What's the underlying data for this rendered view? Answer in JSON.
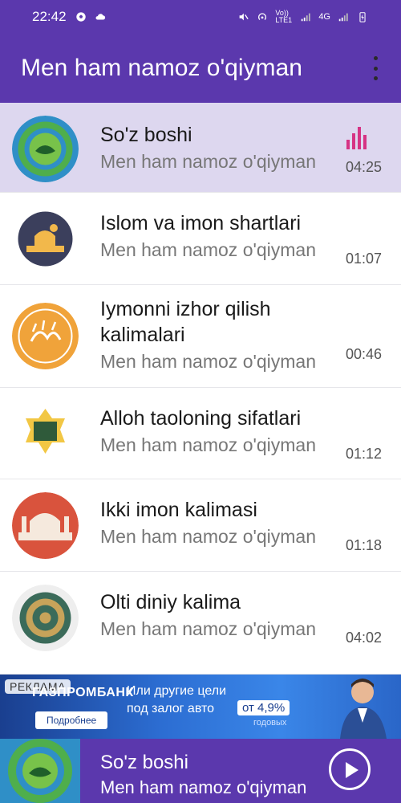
{
  "status": {
    "time": "22:42",
    "left_icons": [
      "football-icon",
      "cloud-icon"
    ],
    "right_icons": [
      "mute-icon",
      "hotspot-icon",
      "volte-icon",
      "signal-icon",
      "signal-icon",
      "battery-charging-icon"
    ],
    "volte": "Vo)) LTE1",
    "net": "4G"
  },
  "appbar": {
    "title": "Men ham namoz o'qiyman",
    "menu_icon": "more-vert-icon"
  },
  "items": [
    {
      "title": "So'z boshi",
      "subtitle": "Men ham namoz o'qiyman",
      "duration": "04:25",
      "active": true
    },
    {
      "title": "Islom va imon shartlari",
      "subtitle": "Men ham namoz o'qiyman",
      "duration": "01:07",
      "active": false
    },
    {
      "title": "Iymonni izhor qilish kalimalari",
      "subtitle": "Men ham namoz o'qiyman",
      "duration": "00:46",
      "active": false
    },
    {
      "title": "Alloh taoloning sifatlari",
      "subtitle": "Men ham namoz o'qiyman",
      "duration": "01:12",
      "active": false
    },
    {
      "title": "Ikki imon kalimasi",
      "subtitle": "Men ham namoz o'qiyman",
      "duration": "01:18",
      "active": false
    },
    {
      "title": "Olti diniy kalima",
      "subtitle": "Men ham namoz o'qiyman",
      "duration": "04:02",
      "active": false
    }
  ],
  "ad": {
    "tag": "РЕКЛАМА",
    "bank": "ГАЗПРОМБАНК",
    "button": "Подробнее",
    "line1": "Или другие цели",
    "line2": "под залог авто",
    "rate": "от 4,9%",
    "years": "годовых"
  },
  "player": {
    "title": "So'z boshi",
    "subtitle": "Men ham namoz o'qiyman",
    "play_icon": "play-icon"
  },
  "colors": {
    "primary": "#5b38ad",
    "active_row": "#ddd7ef",
    "equalizer": "#d63384"
  }
}
